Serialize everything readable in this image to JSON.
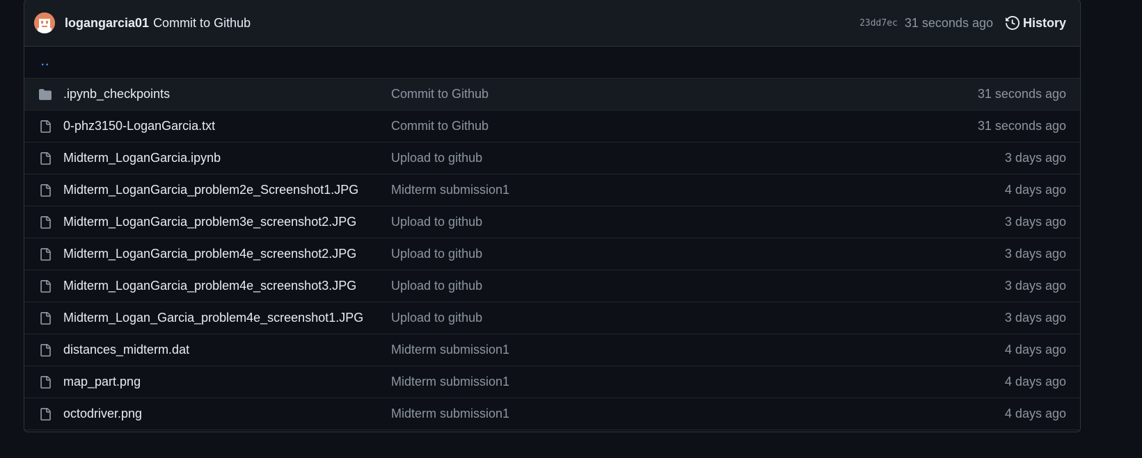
{
  "header": {
    "author": "logangarcia01",
    "commit_message": "Commit to Github",
    "sha": "23dd7ec",
    "time_ago": "31 seconds ago",
    "history_label": "History"
  },
  "parent_dir": "..",
  "files": [
    {
      "type": "folder",
      "name": ".ipynb_checkpoints",
      "message": "Commit to Github",
      "date": "31 seconds ago"
    },
    {
      "type": "file",
      "name": "0-phz3150-LoganGarcia.txt",
      "message": "Commit to Github",
      "date": "31 seconds ago"
    },
    {
      "type": "file",
      "name": "Midterm_LoganGarcia.ipynb",
      "message": "Upload to github",
      "date": "3 days ago"
    },
    {
      "type": "file",
      "name": "Midterm_LoganGarcia_problem2e_Screenshot1.JPG",
      "message": "Midterm submission1",
      "date": "4 days ago"
    },
    {
      "type": "file",
      "name": "Midterm_LoganGarcia_problem3e_screenshot2.JPG",
      "message": "Upload to github",
      "date": "3 days ago"
    },
    {
      "type": "file",
      "name": "Midterm_LoganGarcia_problem4e_screenshot2.JPG",
      "message": "Upload to github",
      "date": "3 days ago"
    },
    {
      "type": "file",
      "name": "Midterm_LoganGarcia_problem4e_screenshot3.JPG",
      "message": "Upload to github",
      "date": "3 days ago"
    },
    {
      "type": "file",
      "name": "Midterm_Logan_Garcia_problem4e_screenshot1.JPG",
      "message": "Upload to github",
      "date": "3 days ago"
    },
    {
      "type": "file",
      "name": "distances_midterm.dat",
      "message": "Midterm submission1",
      "date": "4 days ago"
    },
    {
      "type": "file",
      "name": "map_part.png",
      "message": "Midterm submission1",
      "date": "4 days ago"
    },
    {
      "type": "file",
      "name": "octodriver.png",
      "message": "Midterm submission1",
      "date": "4 days ago"
    }
  ],
  "colors": {
    "background": "#0d1117",
    "header_bg": "#161b22",
    "link": "#4493f8",
    "muted": "#8d96a0",
    "avatar": "#e2855f"
  }
}
